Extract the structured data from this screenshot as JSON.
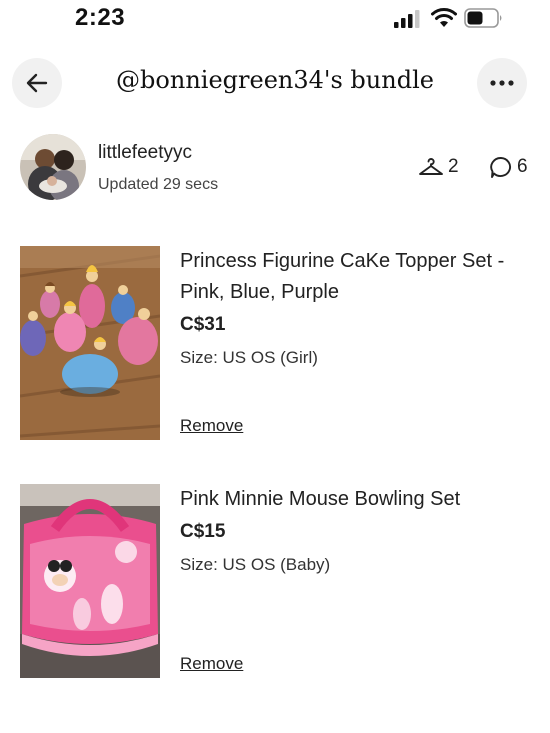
{
  "status_bar": {
    "time": "2:23"
  },
  "header": {
    "title": "@bonniegreen34's bundle"
  },
  "seller": {
    "username": "littlefeetyyc",
    "updated": "Updated 29 secs",
    "likes_count": "2",
    "comments_count": "6"
  },
  "items": [
    {
      "title": "Princess Figurine CaKe Topper Set - Pink, Blue, Purple",
      "price": "C$31",
      "size": "Size: US OS (Girl)",
      "remove_label": "Remove"
    },
    {
      "title": "Pink Minnie Mouse Bowling Set",
      "price": "C$15",
      "size": "Size: US OS (Baby)",
      "remove_label": "Remove"
    }
  ],
  "icons": {
    "back": "arrow-left-icon",
    "more": "more-horizontal-icon",
    "likes": "hanger-icon",
    "comments": "comment-bubble-icon"
  }
}
